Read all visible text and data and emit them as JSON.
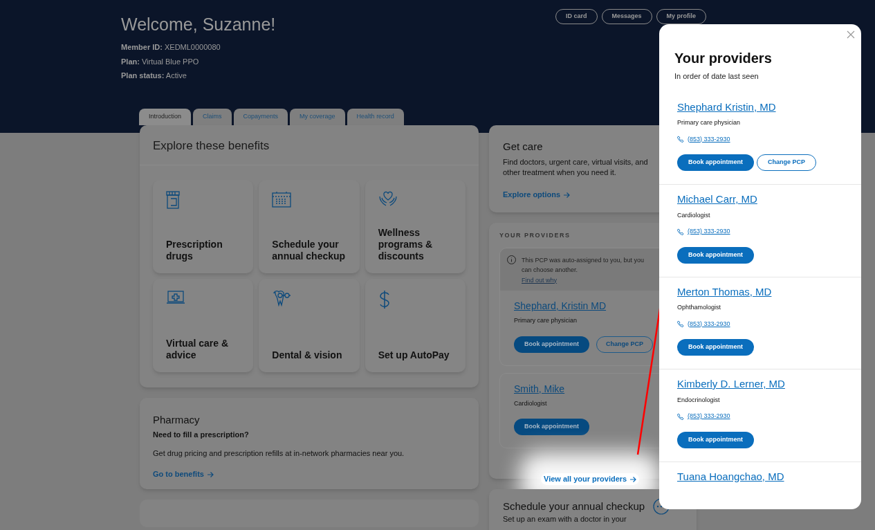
{
  "header": {
    "greeting": "Welcome, Suzanne!",
    "details": [
      {
        "label": "Member ID:",
        "value": "XEDML0000080"
      },
      {
        "label": "Plan:",
        "value": "Virtual Blue PPO"
      },
      {
        "label": "Plan status:",
        "value": "Active"
      }
    ],
    "buttons": [
      "ID card",
      "Messages",
      "My profile"
    ]
  },
  "tabs": [
    {
      "label": "Introduction",
      "selected": true
    },
    {
      "label": "Claims",
      "selected": false
    },
    {
      "label": "Copayments",
      "selected": false
    },
    {
      "label": "My coverage",
      "selected": false
    },
    {
      "label": "Health record",
      "selected": false
    }
  ],
  "benefits": {
    "title": "Explore these benefits",
    "tiles": [
      {
        "label": "Prescription drugs"
      },
      {
        "label": "Schedule your annual checkup"
      },
      {
        "label": "Wellness programs & discounts"
      },
      {
        "label": "Virtual care & advice"
      },
      {
        "label": "Dental & vision"
      },
      {
        "label": "Set up AutoPay"
      }
    ]
  },
  "pharmacy": {
    "title": "Pharmacy",
    "subtitle": "Need to fill a prescription?",
    "text": "Get drug pricing and prescription refills at in-network pharmacies near you.",
    "link": "Go to benefits"
  },
  "get_care": {
    "title": "Get care",
    "text": "Find doctors, urgent care, virtual visits, and other treatment when you need it.",
    "link": "Explore options"
  },
  "your_providers": {
    "heading": "YOUR PROVIDERS",
    "notice": {
      "text": "This PCP was auto-assigned to you, but you can choose another.",
      "link": "Find out why"
    },
    "providers": [
      {
        "name": "Shephard, Kristin MD",
        "specialty": "Primary care physician",
        "buttons": [
          {
            "label": "Book appointment",
            "kind": "primary"
          },
          {
            "label": "Change PCP",
            "kind": "secondary"
          }
        ]
      },
      {
        "name": "Smith, Mike",
        "specialty": "Cardiologist",
        "buttons": [
          {
            "label": "Book appointment",
            "kind": "primary"
          }
        ]
      }
    ],
    "link": "View all your providers"
  },
  "schedule_card": {
    "title": "Schedule your annual checkup",
    "text": "Set up an exam with a doctor in your"
  },
  "modal": {
    "title": "Your providers",
    "subtitle": "In order of date last seen",
    "providers": [
      {
        "name": "Shephard Kristin, MD",
        "specialty": "Primary care physician",
        "phone": "(853) 333-2930",
        "buttons": [
          {
            "label": "Book appointment",
            "kind": "primary"
          },
          {
            "label": "Change PCP",
            "kind": "secondary"
          }
        ]
      },
      {
        "name": "Michael Carr, MD",
        "specialty": "Cardiologist",
        "phone": "(853) 333-2930",
        "buttons": [
          {
            "label": "Book appointment",
            "kind": "primary"
          }
        ]
      },
      {
        "name": "Merton Thomas, MD",
        "specialty": "Ophthamologist",
        "phone": "(853) 333-2930",
        "buttons": [
          {
            "label": "Book appointment",
            "kind": "primary"
          }
        ]
      },
      {
        "name": "Kimberly D. Lerner, MD",
        "specialty": "Endocrinologist",
        "phone": "(853) 333-2930",
        "buttons": [
          {
            "label": "Book appointment",
            "kind": "primary"
          }
        ]
      },
      {
        "name": "Tuana Hoangchao, MD"
      }
    ]
  }
}
